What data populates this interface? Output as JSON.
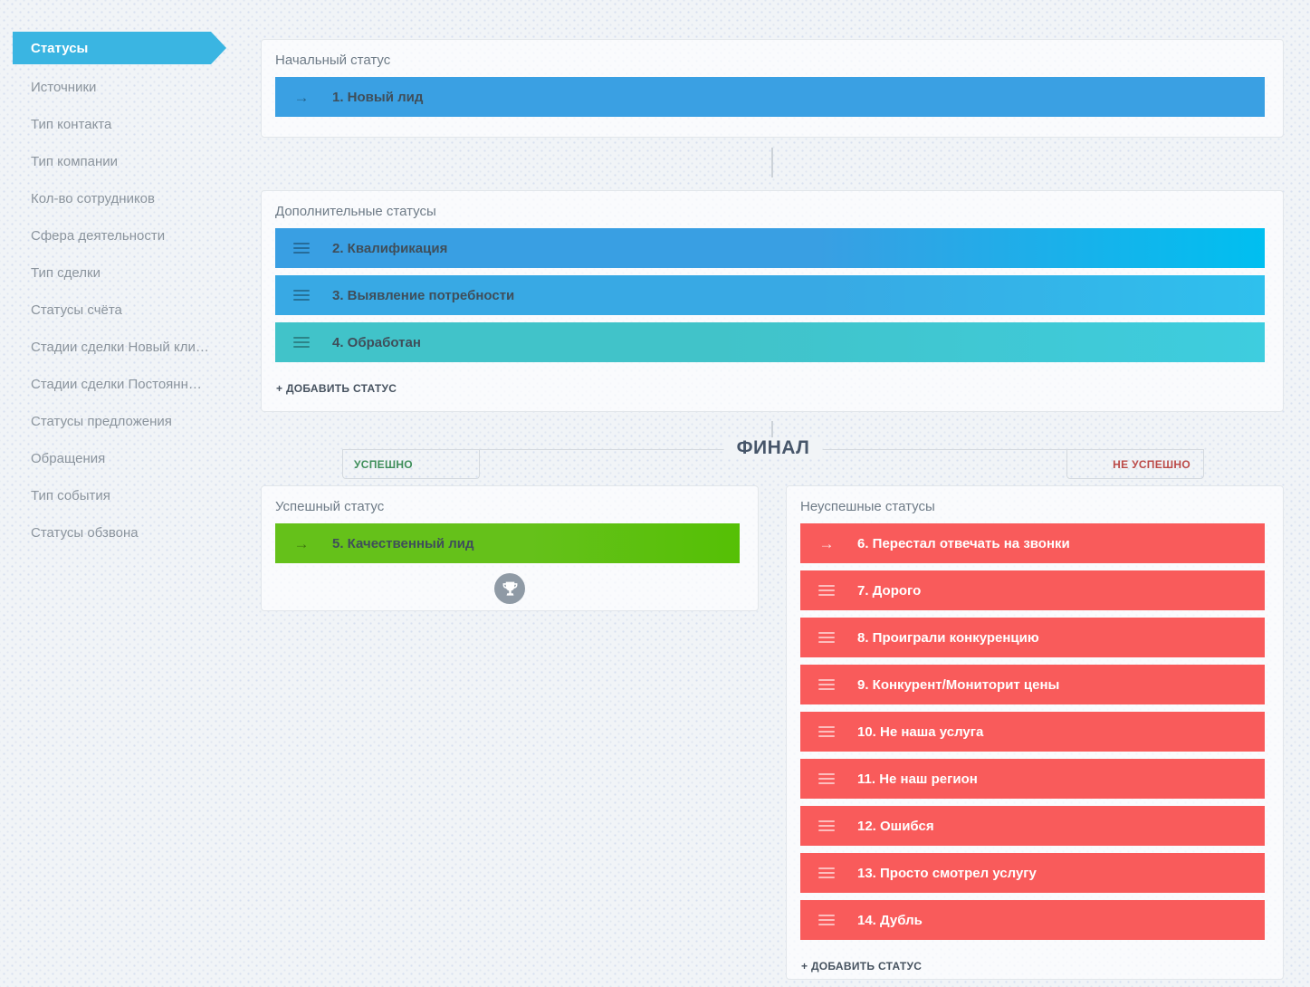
{
  "sidebar": {
    "items": [
      {
        "label": "Статусы",
        "active": true
      },
      {
        "label": "Источники"
      },
      {
        "label": "Тип контакта"
      },
      {
        "label": "Тип компании"
      },
      {
        "label": "Кол-во сотрудников"
      },
      {
        "label": "Сфера деятельности"
      },
      {
        "label": "Тип сделки"
      },
      {
        "label": "Статусы счёта"
      },
      {
        "label": "Стадии сделки Новый кли…"
      },
      {
        "label": "Стадии сделки Постоянн…"
      },
      {
        "label": "Статусы предложения"
      },
      {
        "label": "Обращения"
      },
      {
        "label": "Тип события"
      },
      {
        "label": "Статусы обзвона"
      }
    ]
  },
  "colors": {
    "active_tab_blue": "#3ab5e2",
    "status_blue": "#3aa0e3",
    "status_cyan": "#00bff0",
    "status_teal": "#40c4cf",
    "status_green": "#63c214",
    "status_red": "#f95b5b",
    "success_tab_text": "#3e8e5a",
    "fail_tab_text": "#bb4a48"
  },
  "initial_panel": {
    "title": "Начальный статус",
    "statuses": [
      {
        "label": "1. Новый лид",
        "icon": "arrow",
        "color": "c-blue1"
      }
    ]
  },
  "additional_panel": {
    "title": "Дополнительные статусы",
    "add_label": "+ ДОБАВИТЬ СТАТУС",
    "statuses": [
      {
        "label": "2. Квалификация",
        "icon": "drag",
        "color": "c-blue2"
      },
      {
        "label": "3. Выявление потребности",
        "icon": "drag",
        "color": "c-blue3"
      },
      {
        "label": "4. Обработан",
        "icon": "drag",
        "color": "c-teal"
      }
    ]
  },
  "final": {
    "divider_label": "ФИНАЛ",
    "success_tab": "УСПЕШНО",
    "fail_tab": "НЕ УСПЕШНО"
  },
  "success_panel": {
    "title": "Успешный статус",
    "trophy_icon": "trophy",
    "statuses": [
      {
        "label": "5. Качественный лид",
        "icon": "arrow",
        "color": "c-green"
      }
    ]
  },
  "failed_panel": {
    "title": "Неуспешные статусы",
    "add_label": "+ ДОБАВИТЬ СТАТУС",
    "statuses": [
      {
        "label": "6. Перестал отвечать на звонки",
        "icon": "arrow",
        "color": "c-red"
      },
      {
        "label": "7. Дорого",
        "icon": "drag",
        "color": "c-red"
      },
      {
        "label": "8. Проиграли конкуренцию",
        "icon": "drag",
        "color": "c-red"
      },
      {
        "label": "9. Конкурент/Мониторит цены",
        "icon": "drag",
        "color": "c-red"
      },
      {
        "label": "10. Не наша услуга",
        "icon": "drag",
        "color": "c-red"
      },
      {
        "label": "11. Не наш регион",
        "icon": "drag",
        "color": "c-red"
      },
      {
        "label": "12. Ошибся",
        "icon": "drag",
        "color": "c-red"
      },
      {
        "label": "13. Просто смотрел услугу",
        "icon": "drag",
        "color": "c-red"
      },
      {
        "label": "14. Дубль",
        "icon": "drag",
        "color": "c-red"
      }
    ]
  }
}
